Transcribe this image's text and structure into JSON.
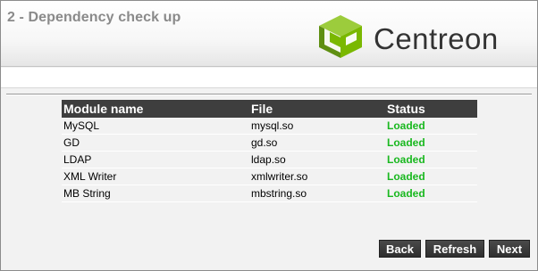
{
  "header": {
    "step_title": "2 - Dependency check up",
    "logo_text": "Centreon",
    "logo_color": "#7ab800"
  },
  "table": {
    "columns": [
      "Module name",
      "File",
      "Status"
    ],
    "rows": [
      {
        "module": "MySQL",
        "file": "mysql.so",
        "status": "Loaded"
      },
      {
        "module": "GD",
        "file": "gd.so",
        "status": "Loaded"
      },
      {
        "module": "LDAP",
        "file": "ldap.so",
        "status": "Loaded"
      },
      {
        "module": "XML Writer",
        "file": "xmlwriter.so",
        "status": "Loaded"
      },
      {
        "module": "MB String",
        "file": "mbstring.so",
        "status": "Loaded"
      }
    ],
    "status_color": "#19b81f"
  },
  "buttons": {
    "back": "Back",
    "refresh": "Refresh",
    "next": "Next"
  }
}
